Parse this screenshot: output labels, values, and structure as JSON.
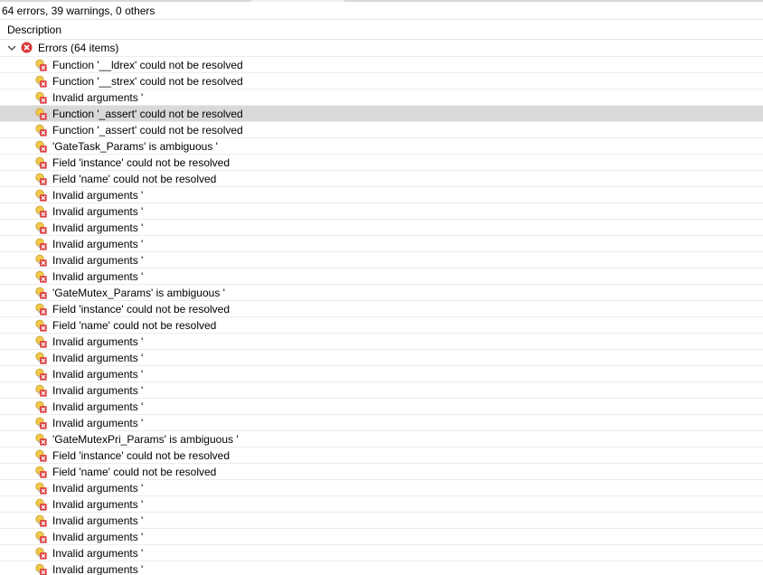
{
  "summary": "64 errors, 39 warnings, 0 others",
  "column": {
    "description": "Description"
  },
  "group": {
    "label": "Errors (64 items)",
    "expanded": true
  },
  "selected_row": 3,
  "items": [
    {
      "label": "Function '__ldrex' could not be resolved"
    },
    {
      "label": "Function '__strex' could not be resolved"
    },
    {
      "label": "Invalid arguments '"
    },
    {
      "label": "Function '_assert' could not be resolved"
    },
    {
      "label": "Function '_assert' could not be resolved"
    },
    {
      "label": "'GateTask_Params' is ambiguous '"
    },
    {
      "label": "Field 'instance' could not be resolved"
    },
    {
      "label": "Field 'name' could not be resolved"
    },
    {
      "label": "Invalid arguments '"
    },
    {
      "label": "Invalid arguments '"
    },
    {
      "label": "Invalid arguments '"
    },
    {
      "label": "Invalid arguments '"
    },
    {
      "label": "Invalid arguments '"
    },
    {
      "label": "Invalid arguments '"
    },
    {
      "label": "'GateMutex_Params' is ambiguous '"
    },
    {
      "label": "Field 'instance' could not be resolved"
    },
    {
      "label": "Field 'name' could not be resolved"
    },
    {
      "label": "Invalid arguments '"
    },
    {
      "label": "Invalid arguments '"
    },
    {
      "label": "Invalid arguments '"
    },
    {
      "label": "Invalid arguments '"
    },
    {
      "label": "Invalid arguments '"
    },
    {
      "label": "Invalid arguments '"
    },
    {
      "label": "'GateMutexPri_Params' is ambiguous '"
    },
    {
      "label": "Field 'instance' could not be resolved"
    },
    {
      "label": "Field 'name' could not be resolved"
    },
    {
      "label": "Invalid arguments '"
    },
    {
      "label": "Invalid arguments '"
    },
    {
      "label": "Invalid arguments '"
    },
    {
      "label": "Invalid arguments '"
    },
    {
      "label": "Invalid arguments '"
    },
    {
      "label": "Invalid arguments '"
    }
  ],
  "icons": {
    "group": "error-circle-icon",
    "item": "error-bulb-icon",
    "chevron": "chevron-down-icon"
  },
  "colors": {
    "error_red": "#d9383a",
    "bulb_yellow": "#f2c94c",
    "selection": "#d9d9d9"
  }
}
